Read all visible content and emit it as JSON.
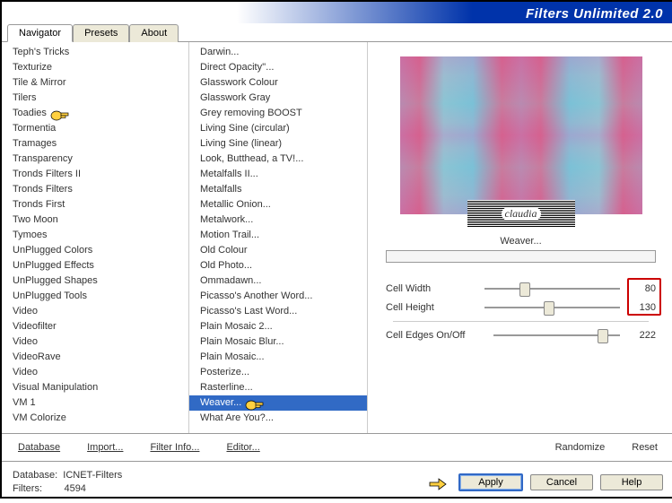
{
  "title": "Filters Unlimited 2.0",
  "tabs": [
    "Navigator",
    "Presets",
    "About"
  ],
  "list1": [
    "Teph's Tricks",
    "Texturize",
    "Tile & Mirror",
    "Tilers",
    "Toadies",
    "Tormentia",
    "Tramages",
    "Transparency",
    "Tronds Filters II",
    "Tronds Filters",
    "Tronds First",
    "Two Moon",
    "Tymoes",
    "UnPlugged Colors",
    "UnPlugged Effects",
    "UnPlugged Shapes",
    "UnPlugged Tools",
    "Video",
    "Videofilter",
    "Video",
    "VideoRave",
    "Video",
    "Visual Manipulation",
    "VM 1",
    "VM Colorize"
  ],
  "list2": [
    "Darwin...",
    "Direct Opacity''...",
    "Glasswork Colour",
    "Glasswork Gray",
    "Grey removing BOOST",
    "Living Sine (circular)",
    "Living Sine (linear)",
    "Look, Butthead, a TV!...",
    "Metalfalls II...",
    "Metalfalls",
    "Metallic Onion...",
    "Metalwork...",
    "Motion Trail...",
    "Old Colour",
    "Old Photo...",
    "Ommadawn...",
    "Picasso's Another Word...",
    "Picasso's Last Word...",
    "Plain Mosaic 2...",
    "Plain Mosaic Blur...",
    "Plain Mosaic...",
    "Posterize...",
    "Rasterline...",
    "Weaver...",
    "What Are You?..."
  ],
  "watermark": "claudia",
  "filter_name": "Weaver...",
  "params": [
    {
      "label": "Cell Width",
      "val": "80",
      "thumb": 26
    },
    {
      "label": "Cell Height",
      "val": "130",
      "thumb": 44
    }
  ],
  "param3": {
    "label": "Cell Edges On/Off",
    "val": "222",
    "thumb": 82
  },
  "toolbar": {
    "database": "Database",
    "import": "Import...",
    "filterinfo": "Filter Info...",
    "editor": "Editor...",
    "randomize": "Randomize",
    "reset": "Reset"
  },
  "status": {
    "db_label": "Database:",
    "db_val": "ICNET-Filters",
    "filters_label": "Filters:",
    "filters_val": "4594"
  },
  "buttons": {
    "apply": "Apply",
    "cancel": "Cancel",
    "help": "Help"
  }
}
